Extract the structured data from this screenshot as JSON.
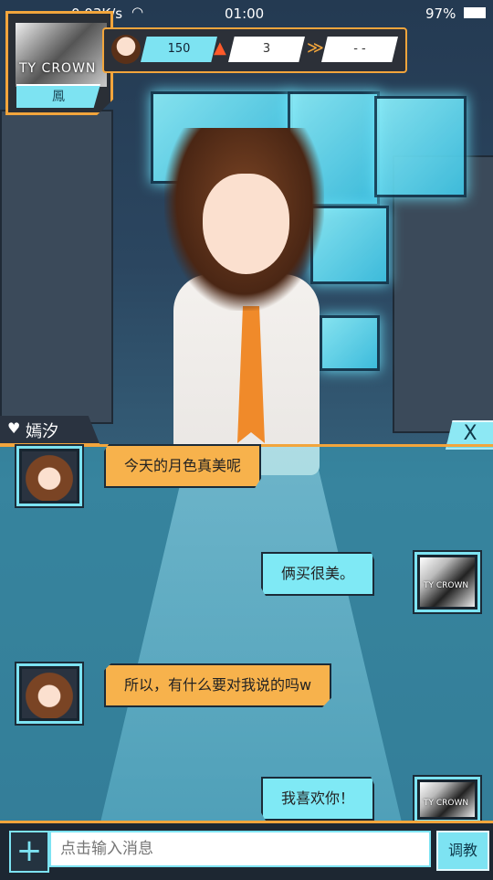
{
  "status_bar": {
    "network_speed": "0.03K/s",
    "time": "01:00",
    "battery": "97%"
  },
  "player": {
    "brand_text": "TY CROWN",
    "name": "鳳"
  },
  "stats": {
    "value_1": "150",
    "value_2": "3",
    "value_3": "- -"
  },
  "character": {
    "name": "嫣汐"
  },
  "close_label": "X",
  "messages": [
    {
      "side": "left",
      "text": "今天的月色真美呢"
    },
    {
      "side": "right",
      "text": "俩买很美。"
    },
    {
      "side": "left",
      "text": "所以，有什么要对我说的吗w"
    },
    {
      "side": "right",
      "text": "我喜欢你！"
    }
  ],
  "input": {
    "placeholder": "点击输入消息",
    "plus_label": "+",
    "teach_label": "调教"
  },
  "colors": {
    "accent_orange": "#f2a53c",
    "accent_cyan": "#7de3f2",
    "bubble_left": "#f7b24c",
    "bubble_right": "#7fe9f5"
  },
  "icons": {
    "stat_1": "triangle-icon",
    "stat_2": "flame-icon",
    "stat_3": "wings-icon"
  }
}
